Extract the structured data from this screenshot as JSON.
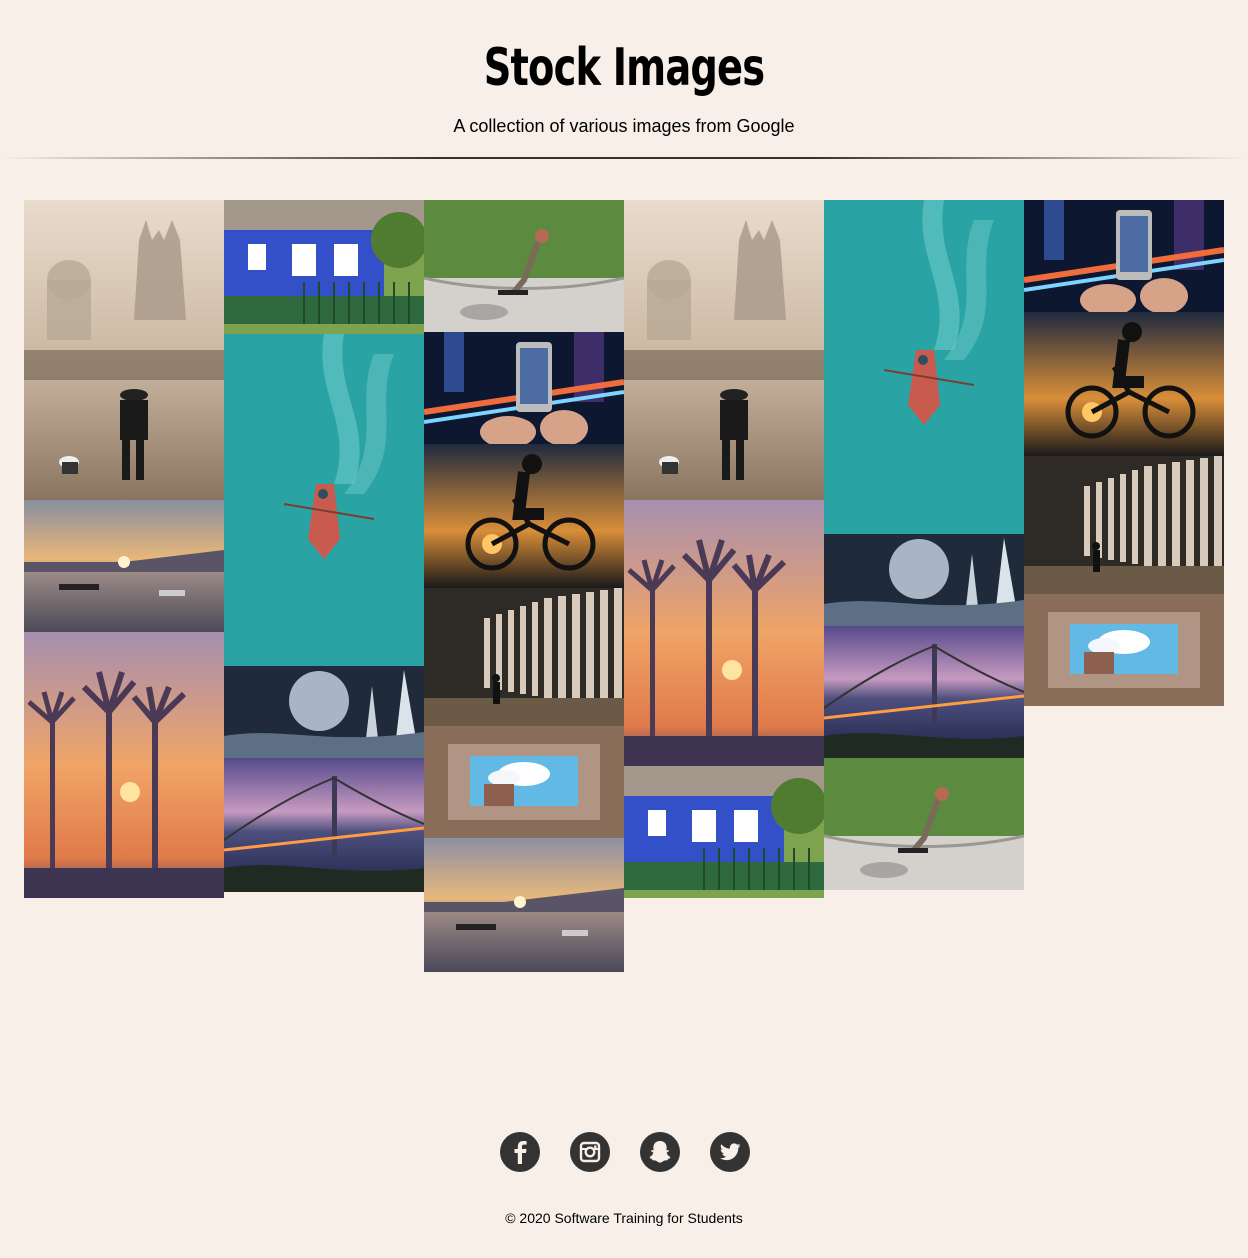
{
  "header": {
    "title": "Stock Images",
    "subtitle": "A collection of various images from Google"
  },
  "gallery": {
    "columns": [
      [
        "city-street-with-dog-photo",
        "lake-sunset-boats-photo",
        "palm-trees-sunset-photo"
      ],
      [
        "blue-thatched-cottage-photo",
        "rowboat-in-teal-water-photo",
        "moon-over-frozen-spires-photo",
        "suspension-bridge-dusk-photo"
      ],
      [
        "skateboarder-in-bowl-photo",
        "phone-capturing-city-lights-photo",
        "cyclist-silhouette-sunset-photo",
        "person-in-lit-corridor-photo",
        "courtyard-sky-from-below-photo",
        "lake-sunset-boats-photo"
      ],
      [
        "city-street-with-dog-photo",
        "palm-trees-sunset-photo",
        "blue-thatched-cottage-photo"
      ],
      [
        "rowboat-in-teal-water-photo",
        "moon-over-frozen-spires-photo",
        "suspension-bridge-dusk-photo",
        "skateboarder-in-bowl-photo"
      ],
      [
        "phone-capturing-city-lights-photo",
        "cyclist-silhouette-sunset-photo",
        "person-in-lit-corridor-photo",
        "courtyard-sky-from-below-photo"
      ]
    ]
  },
  "footer": {
    "social": [
      {
        "name": "facebook-icon"
      },
      {
        "name": "instagram-icon"
      },
      {
        "name": "snapchat-icon"
      },
      {
        "name": "twitter-icon"
      }
    ],
    "copyright": "© 2020 Software Training for Students"
  },
  "colors": {
    "background": "#f7efe8",
    "icon_circle": "#333333"
  }
}
